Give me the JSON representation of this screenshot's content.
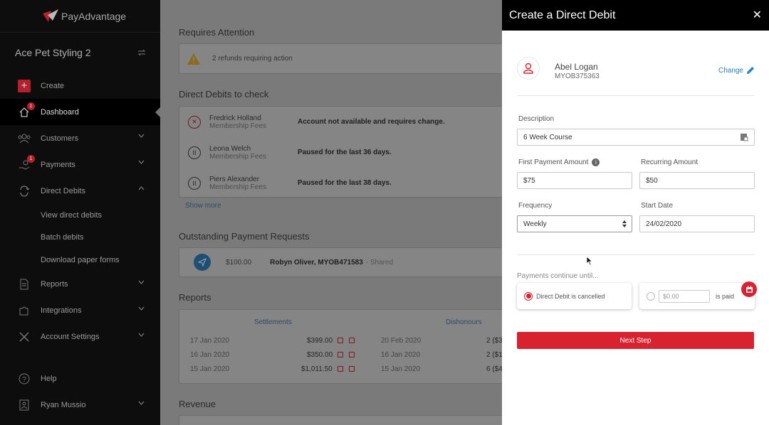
{
  "brand": {
    "name": "PayAdvantage"
  },
  "sidebar": {
    "org_name": "Ace Pet Styling 2",
    "items": [
      {
        "label": "Create",
        "icon": "plus-icon"
      },
      {
        "label": "Dashboard",
        "icon": "home-icon",
        "badge": "1"
      },
      {
        "label": "Customers",
        "icon": "users-icon"
      },
      {
        "label": "Payments",
        "icon": "payments-icon",
        "badge": "1"
      },
      {
        "label": "Direct Debits",
        "icon": "refresh-icon"
      },
      {
        "label": "Reports",
        "icon": "document-icon"
      },
      {
        "label": "Integrations",
        "icon": "puzzle-icon"
      },
      {
        "label": "Account Settings",
        "icon": "tools-icon"
      },
      {
        "label": "Help",
        "icon": "help-icon"
      },
      {
        "label": "Ryan Mussio",
        "icon": "user-badge-icon"
      }
    ],
    "sub_items": [
      "View direct debits",
      "Batch debits",
      "Download paper forms"
    ]
  },
  "main": {
    "requires_attention": {
      "title": "Requires Attention",
      "message": "2 refunds requiring action"
    },
    "direct_debits": {
      "title": "Direct Debits to check",
      "rows": [
        {
          "name": "Fredrick Holland",
          "sub": "Membership Fees",
          "message": "Account not available and requires change.",
          "icon": "x-circle-icon"
        },
        {
          "name": "Leona Welch",
          "sub": "Membership Fees",
          "message": "Paused for the last 36 days.",
          "icon": "pause-circle-icon"
        },
        {
          "name": "Piers Alexander",
          "sub": "Membership Fees",
          "message": "Paused for the last 38 days.",
          "icon": "pause-circle-icon"
        }
      ],
      "show_more": "Show more"
    },
    "outstanding": {
      "title": "Outstanding Payment Requests",
      "amount": "$100.00",
      "customer": "Robyn Oliver, MYOB471583",
      "status": "- Shared"
    },
    "reports": {
      "title": "Reports",
      "settlements_label": "Settlements",
      "dishonours_label": "Dishonours",
      "settlements": [
        {
          "date": "17 Jan 2020",
          "amount": "$399.00"
        },
        {
          "date": "16 Jan 2020",
          "amount": "$350.00"
        },
        {
          "date": "15 Jan 2020",
          "amount": "$1,011.50"
        }
      ],
      "dishonours": [
        {
          "date": "20 Feb 2020",
          "count": "2 ($3"
        },
        {
          "date": "16 Jan 2020",
          "count": "2 ($1"
        },
        {
          "date": "15 Jan 2020",
          "count": "6 ($4"
        }
      ]
    },
    "revenue": {
      "title": "Revenue"
    }
  },
  "panel": {
    "title": "Create a Direct Debit",
    "customer": {
      "name": "Abel Logan",
      "id": "MYOB375363",
      "change_label": "Change"
    },
    "description": {
      "label": "Description",
      "value": "6 Week Course"
    },
    "first_payment": {
      "label": "First Payment Amount",
      "value": "$75"
    },
    "recurring": {
      "label": "Recurring Amount",
      "value": "$50"
    },
    "frequency": {
      "label": "Frequency",
      "value": "Weekly"
    },
    "start_date": {
      "label": "Start Date",
      "value": "24/02/2020"
    },
    "continue_label": "Payments continue until...",
    "option_cancelled": "Direct Debit is cancelled",
    "option_paid_placeholder": "$0.00",
    "option_paid_suffix": "is paid",
    "next_label": "Next Step"
  },
  "colors": {
    "accent": "#d9222f",
    "link": "#2383c5",
    "sidebar_bg": "#0d0d0d"
  }
}
